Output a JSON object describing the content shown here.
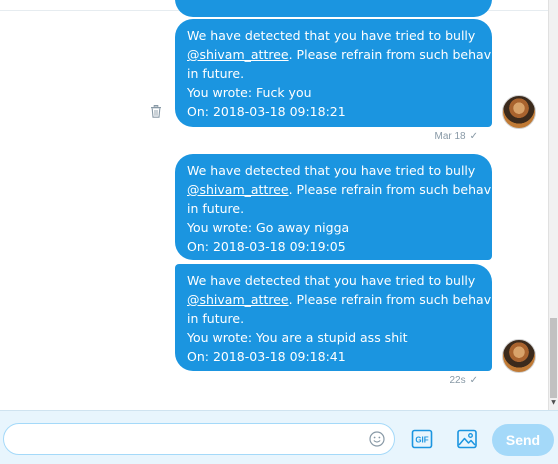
{
  "messages": [
    {
      "lines": [
        "We have detected that you have tried to bully",
        "@shivam_attree",
        ". Please refrain from such behaviour",
        "in future.",
        "You wrote: Fuck you",
        "On: 2018-03-18 09:18:21"
      ]
    },
    {
      "lines": [
        "We have detected that you have tried to bully",
        "@shivam_attree",
        ". Please refrain from such behaviour",
        "in future.",
        "You wrote: Go away nigga",
        "On: 2018-03-18 09:19:05"
      ]
    },
    {
      "lines": [
        "We have detected that you have tried to bully",
        "@shivam_attree",
        ". Please refrain from such behaviour",
        "in future.",
        "You wrote: You are a stupid ass shit",
        "On: 2018-03-18 09:18:41"
      ]
    }
  ],
  "meta": {
    "group1_time": "Mar 18",
    "group2_time": "22s",
    "check": "✓"
  },
  "composer": {
    "placeholder": "",
    "send_label": "Send",
    "gif_label": "GIF"
  },
  "icons": {
    "trash": "trash-icon",
    "emoji": "emoji-icon",
    "gif": "gif-icon",
    "photo": "photo-icon"
  },
  "colors": {
    "bubble": "#1b95e0",
    "composer_bg": "#e8f5fd",
    "send_disabled": "#a4d9f9",
    "meta_text": "#8899a6"
  }
}
